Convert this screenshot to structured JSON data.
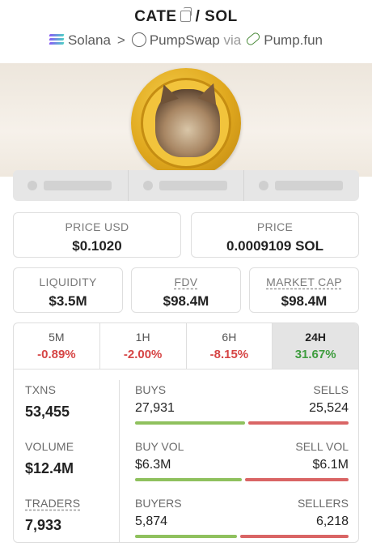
{
  "header": {
    "base": "CATE",
    "separator": "/",
    "quote": "SOL",
    "chain": "Solana",
    "chevron": ">",
    "dex": "PumpSwap",
    "via": "via",
    "launchpad": "Pump.fun"
  },
  "price_usd": {
    "label": "PRICE USD",
    "value": "$0.1020"
  },
  "price": {
    "label": "PRICE",
    "value": "0.0009109 SOL"
  },
  "liquidity": {
    "label": "LIQUIDITY",
    "value": "$3.5M"
  },
  "fdv": {
    "label": "FDV",
    "value": "$98.4M"
  },
  "market_cap": {
    "label": "MARKET CAP",
    "value": "$98.4M"
  },
  "periods": [
    {
      "label": "5M",
      "change": "-0.89%"
    },
    {
      "label": "1H",
      "change": "-2.00%"
    },
    {
      "label": "6H",
      "change": "-8.15%"
    },
    {
      "label": "24H",
      "change": "31.67%"
    }
  ],
  "txns": {
    "label": "TXNS",
    "value": "53,455",
    "buys_label": "BUYS",
    "buys": "27,931",
    "sells_label": "SELLS",
    "sells": "25,524",
    "buy_share": 0.522
  },
  "volume": {
    "label": "VOLUME",
    "value": "$12.4M",
    "buys_label": "BUY VOL",
    "buys": "$6.3M",
    "sells_label": "SELL VOL",
    "sells": "$6.1M",
    "buy_share": 0.508
  },
  "traders": {
    "label": "TRADERS",
    "value": "7,933",
    "buys_label": "BUYERS",
    "buys": "5,874",
    "sells_label": "SELLERS",
    "sells": "6,218",
    "buy_share": 0.486
  },
  "colors": {
    "negative": "#d64545",
    "positive": "#3f9d3f",
    "buy_bar": "#8fc15e",
    "sell_bar": "#d96565"
  }
}
